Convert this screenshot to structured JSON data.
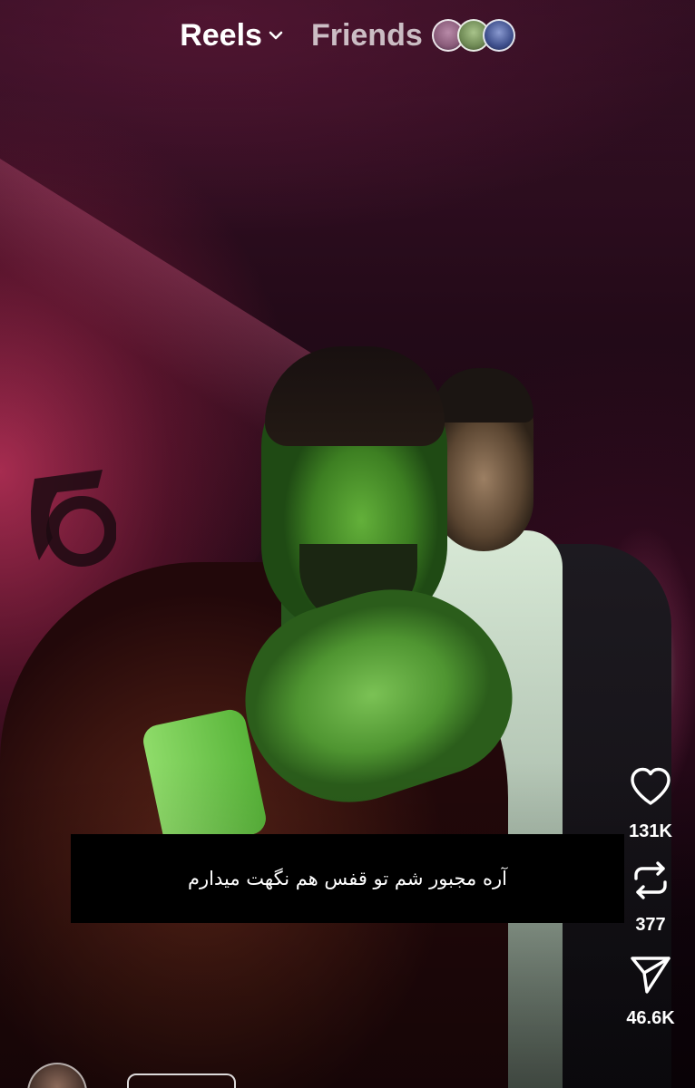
{
  "topbar": {
    "reels_label": "Reels",
    "friends_label": "Friends",
    "friend_avatars": [
      {
        "icon": "friend-avatar",
        "color": "#8a5c7a"
      },
      {
        "icon": "friend-avatar",
        "color": "#6f8a55"
      },
      {
        "icon": "friend-avatar",
        "color": "#3e4f8c"
      }
    ]
  },
  "video": {
    "caption": "آره مجبور شم تو قفس هم نگهت میدارم"
  },
  "actions": {
    "like": {
      "icon": "heart-icon",
      "count": "131K"
    },
    "repost": {
      "icon": "repost-icon",
      "count": "377"
    },
    "share": {
      "icon": "send-icon",
      "count": "46.6K"
    }
  },
  "author": {
    "name": "",
    "follow_label": ""
  },
  "colors": {
    "text": "#ffffff",
    "caption_bg": "#000000"
  }
}
